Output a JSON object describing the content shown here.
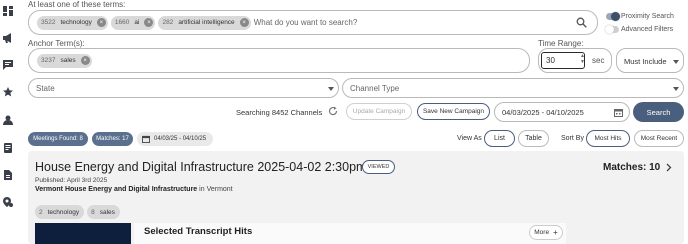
{
  "terms": {
    "label": "At least one of these terms:",
    "chips": [
      {
        "count": "3522",
        "text": "technology"
      },
      {
        "count": "1660",
        "text": "ai"
      },
      {
        "count": "282",
        "text": "artificial intelligence"
      }
    ],
    "placeholder": "What do you want to search?"
  },
  "toggles": {
    "proximity": "Proximity Search",
    "advanced": "Advanced Filters"
  },
  "anchor": {
    "label": "Anchor Term(s):",
    "chips": [
      {
        "count": "3237",
        "text": "sales"
      }
    ]
  },
  "time_range": {
    "label": "Time Range:",
    "value": "30",
    "unit": "sec"
  },
  "must_include": "Must Include",
  "state_placeholder": "State",
  "channel_placeholder": "Channel Type",
  "searching_text": "Searching 8452 Channels",
  "update_campaign": "Update Campaign",
  "save_campaign": "Save New Campaign",
  "date_range": "04/03/2025 - 04/10/2025",
  "search_button": "Search",
  "meetings_found": "Meetings Found: 8",
  "matches_badge": "Matches: 17",
  "date_badge": "04/03/25 - 04/10/25",
  "view_as": {
    "label": "View As",
    "list": "List",
    "table": "Table"
  },
  "sort_by": {
    "label": "Sort By",
    "most_hits": "Most Hits",
    "most_recent": "Most Recent"
  },
  "result": {
    "title": "House Energy and Digital Infrastructure 2025-04-02 2:30pm",
    "viewed": "VIEWED",
    "published": "Published: April 3rd 2025",
    "committee": "Vermont House Energy and Digital Infrastructure",
    "in_text": "in",
    "location": "Vermont",
    "matches": "Matches: 10",
    "term_chips": [
      {
        "count": "2",
        "text": "technology"
      },
      {
        "count": "8",
        "text": "sales"
      }
    ],
    "transcript_title": "Selected Transcript Hits",
    "more_button": "More"
  },
  "colors": {
    "primary": "#4a5e7d",
    "badge": "#5b6f8f",
    "card_bg": "#f2f2f2"
  }
}
